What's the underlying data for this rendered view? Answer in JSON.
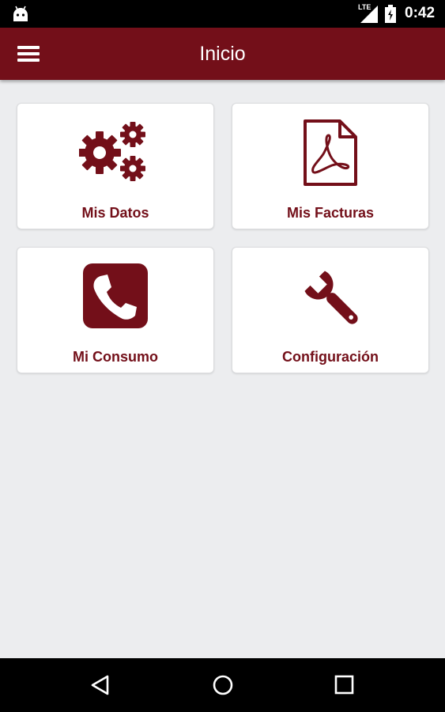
{
  "status_bar": {
    "network": "LTE",
    "time": "0:42",
    "icons": [
      "android-icon",
      "signal-icon",
      "battery-icon"
    ]
  },
  "app_bar": {
    "title": "Inicio",
    "menu_icon": "hamburger-menu-icon"
  },
  "menu": {
    "items": [
      {
        "label": "Mis Datos",
        "icon": "gears-icon"
      },
      {
        "label": "Mis Facturas",
        "icon": "pdf-document-icon"
      },
      {
        "label": "Mi Consumo",
        "icon": "phone-icon"
      },
      {
        "label": "Configuración",
        "icon": "wrench-icon"
      }
    ]
  },
  "nav_bar": {
    "buttons": [
      "back-icon",
      "home-icon",
      "recents-icon"
    ]
  },
  "colors": {
    "primary": "#730F19",
    "background": "#ECEDEF",
    "card": "#FFFFFF"
  }
}
